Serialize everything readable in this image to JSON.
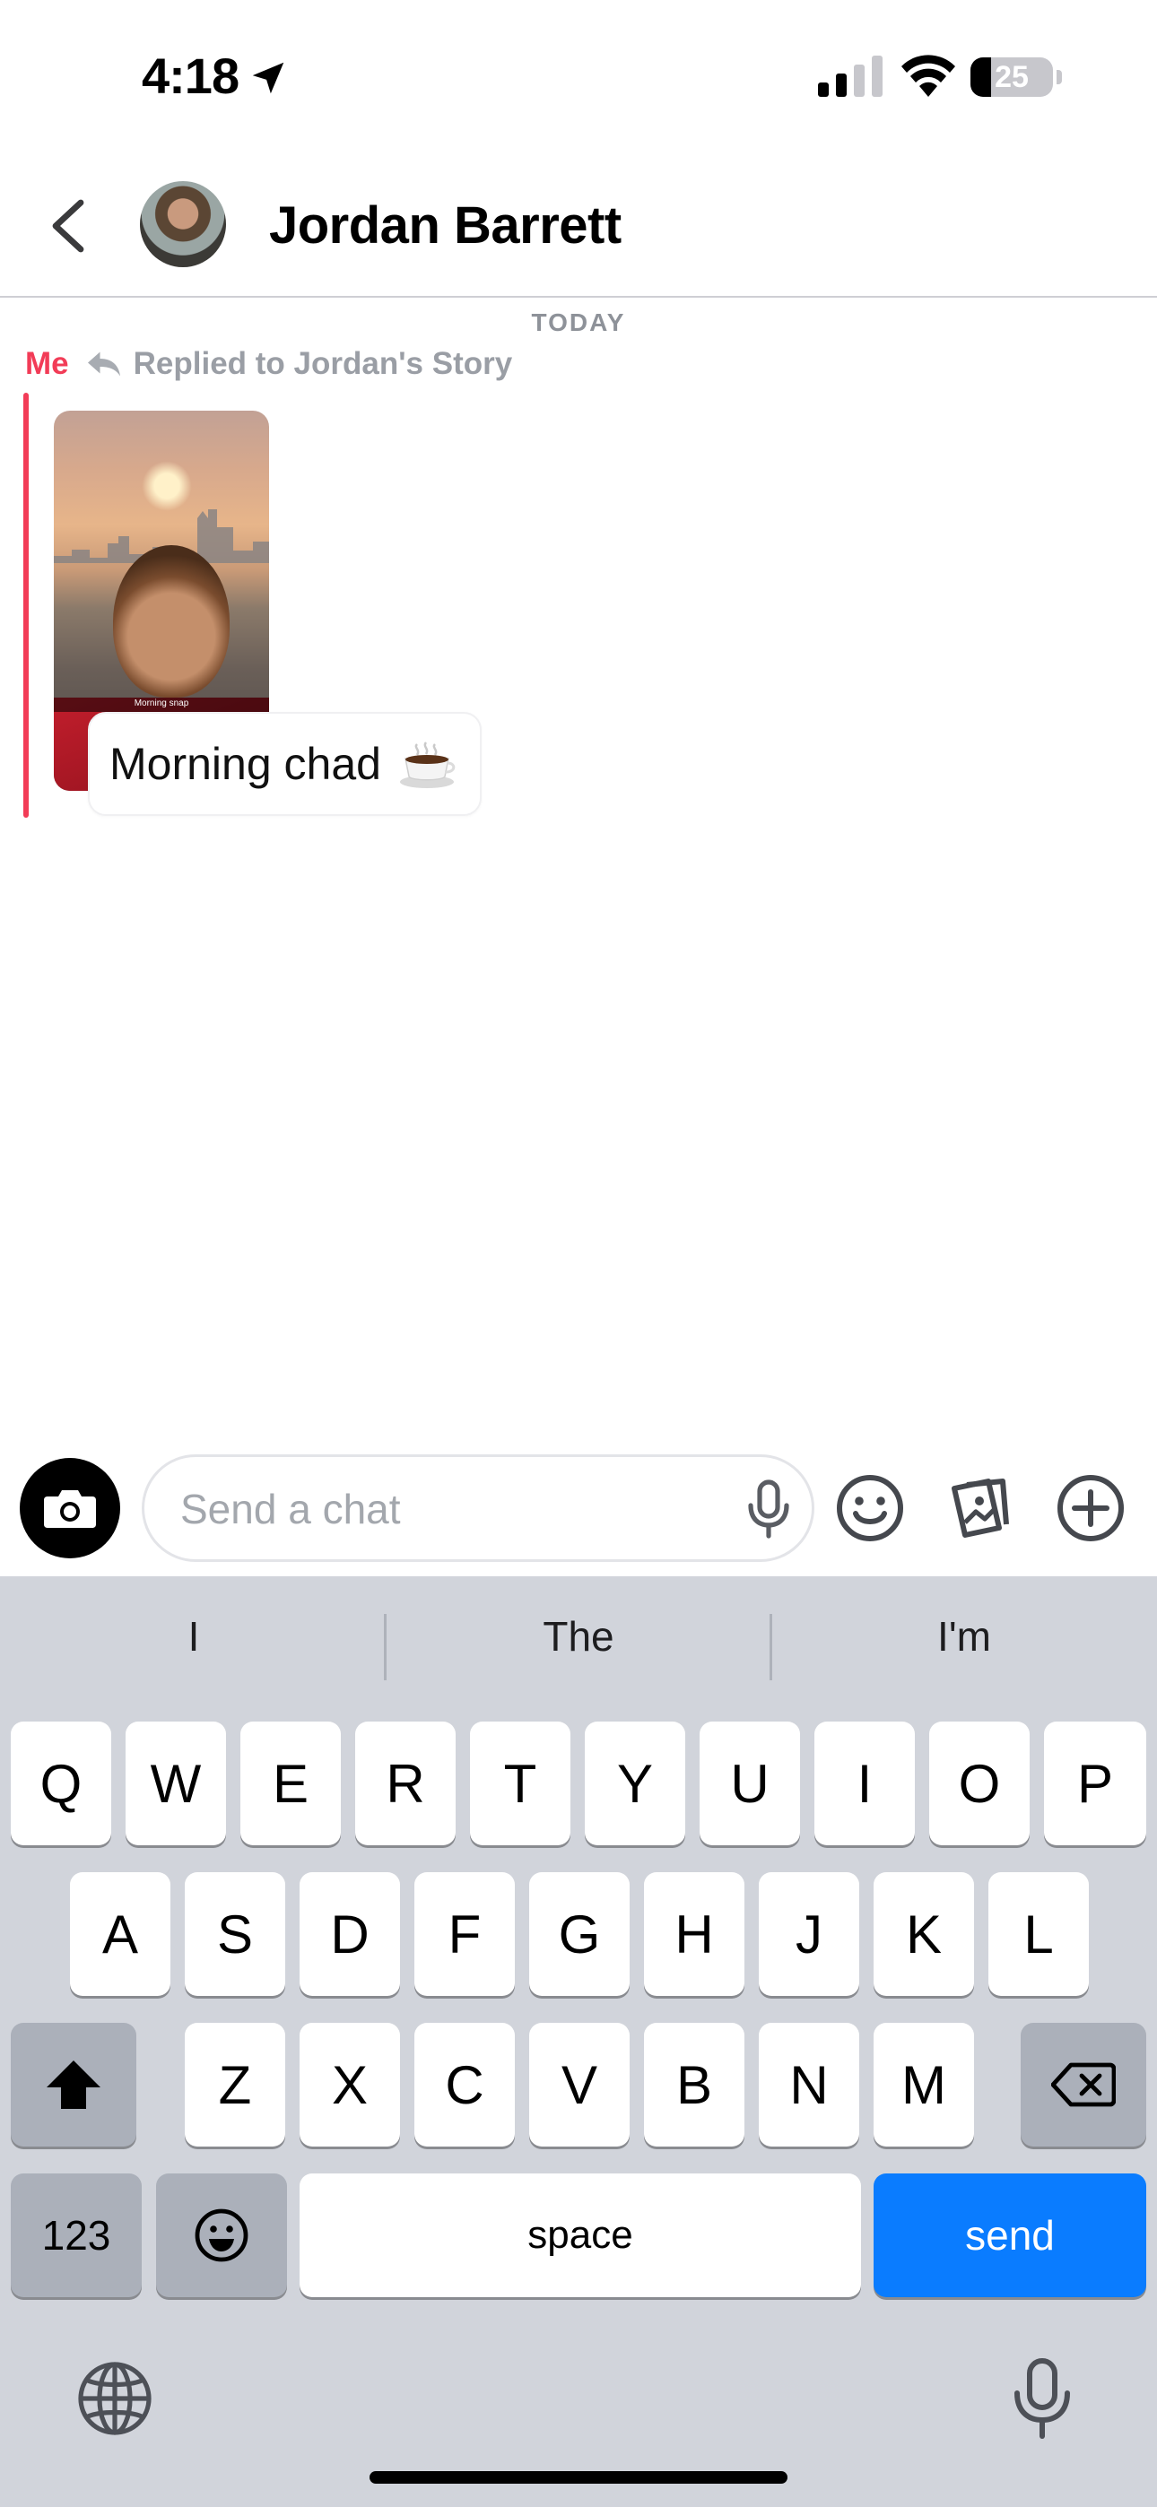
{
  "status_bar": {
    "time": "4:18",
    "battery_level": "25",
    "battery_fraction": 0.25
  },
  "header": {
    "contact_name": "Jordan Barrett"
  },
  "chat": {
    "date_separator": "TODAY",
    "messages": [
      {
        "sender": "Me",
        "reply_context": "Replied to Jordan's Story",
        "story_caption": "Morning snap",
        "text": "Morning chad",
        "emoji_icon": "hot-beverage"
      }
    ],
    "accent_color": "#f23c57"
  },
  "input_bar": {
    "placeholder": "Send a chat",
    "value": ""
  },
  "keyboard": {
    "suggestions": [
      "I",
      "The",
      "I'm"
    ],
    "rows": [
      [
        "Q",
        "W",
        "E",
        "R",
        "T",
        "Y",
        "U",
        "I",
        "O",
        "P"
      ],
      [
        "A",
        "S",
        "D",
        "F",
        "G",
        "H",
        "J",
        "K",
        "L"
      ],
      [
        "Z",
        "X",
        "C",
        "V",
        "B",
        "N",
        "M"
      ]
    ],
    "numbers_label": "123",
    "space_label": "space",
    "send_label": "send",
    "send_color": "#0a7cff"
  }
}
